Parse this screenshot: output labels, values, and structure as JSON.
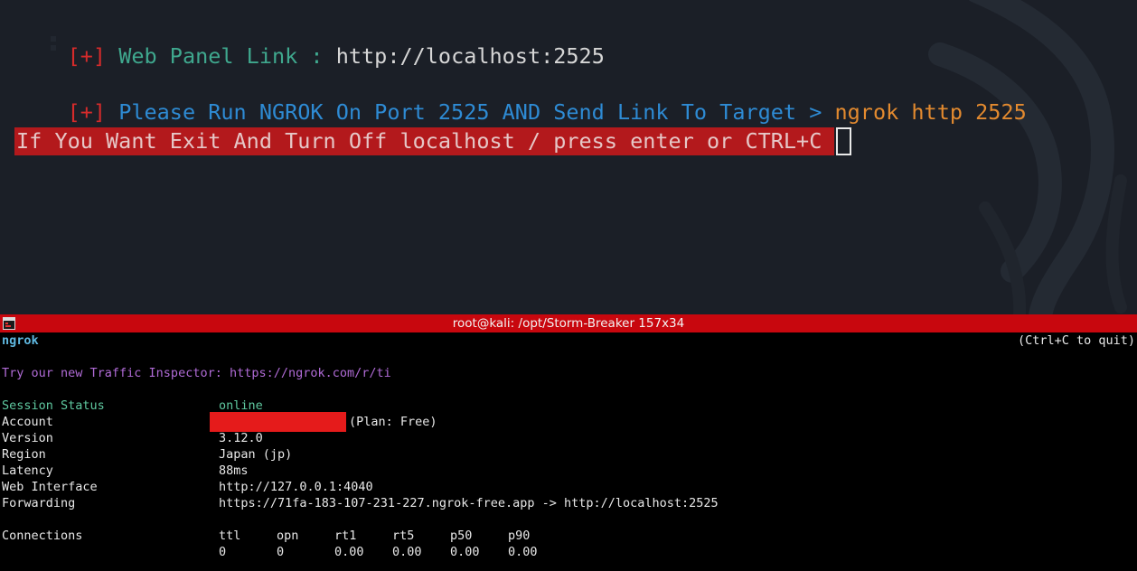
{
  "top_terminal": {
    "line1": {
      "prefix": "[+]",
      "label": "Web Panel Link :",
      "url": "http://localhost:2525"
    },
    "line2": {
      "prefix": "[+]",
      "message": "Please Run NGROK On Port 2525 AND Send Link To Target >",
      "command": "ngrok http 2525"
    },
    "exit_prompt": "If You Want Exit And Turn Off localhost / press enter or CTRL+C"
  },
  "window": {
    "title": "root@kali: /opt/Storm-Breaker 157x34",
    "title_bar_color": "#c8070e"
  },
  "ngrok": {
    "app_name": "ngrok",
    "quit_hint": "(Ctrl+C to quit)",
    "promo": "Try our new Traffic Inspector: https://ngrok.com/r/ti",
    "rows": [
      {
        "label": "Session Status",
        "value": "online"
      },
      {
        "label": "Account",
        "value": "(Plan: Free)"
      },
      {
        "label": "Version",
        "value": "3.12.0"
      },
      {
        "label": "Region",
        "value": "Japan (jp)"
      },
      {
        "label": "Latency",
        "value": "88ms"
      },
      {
        "label": "Web Interface",
        "value": "http://127.0.0.1:4040"
      },
      {
        "label": "Forwarding",
        "value": "https://71fa-183-107-231-227.ngrok-free.app -> http://localhost:2525"
      }
    ],
    "connections": {
      "label": "Connections",
      "headers": [
        "ttl",
        "opn",
        "rt1",
        "rt5",
        "p50",
        "p90"
      ],
      "values": [
        "0",
        "0",
        "0.00",
        "0.00",
        "0.00",
        "0.00"
      ]
    }
  }
}
